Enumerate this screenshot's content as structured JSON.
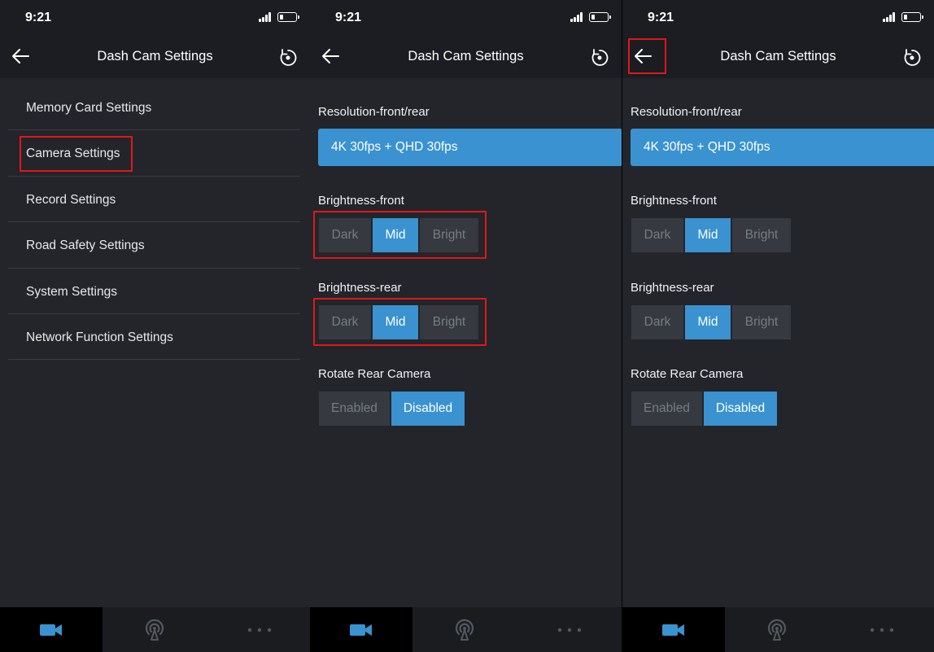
{
  "screens": [
    {
      "status": {
        "time": "9:21"
      },
      "nav": {
        "title": "Dash Cam Settings"
      },
      "menu": [
        {
          "label": "Memory Card Settings"
        },
        {
          "label": "Camera Settings"
        },
        {
          "label": "Record Settings"
        },
        {
          "label": "Road Safety Settings"
        },
        {
          "label": "System Settings"
        },
        {
          "label": "Network Function Settings"
        }
      ]
    },
    {
      "status": {
        "time": "9:21"
      },
      "nav": {
        "title": "Dash Cam Settings"
      },
      "resolution": {
        "label": "Resolution-front/rear",
        "value": "4K 30fps + QHD 30fps"
      },
      "brightness_front": {
        "label": "Brightness-front",
        "options": [
          "Dark",
          "Mid",
          "Bright"
        ],
        "selected": "Mid"
      },
      "brightness_rear": {
        "label": "Brightness-rear",
        "options": [
          "Dark",
          "Mid",
          "Bright"
        ],
        "selected": "Mid"
      },
      "rotate": {
        "label": "Rotate Rear Camera",
        "options": [
          "Enabled",
          "Disabled"
        ],
        "selected": "Disabled"
      }
    },
    {
      "status": {
        "time": "9:21"
      },
      "nav": {
        "title": "Dash Cam Settings"
      },
      "resolution": {
        "label": "Resolution-front/rear",
        "value": "4K 30fps + QHD 30fps"
      },
      "brightness_front": {
        "label": "Brightness-front",
        "options": [
          "Dark",
          "Mid",
          "Bright"
        ],
        "selected": "Mid"
      },
      "brightness_rear": {
        "label": "Brightness-rear",
        "options": [
          "Dark",
          "Mid",
          "Bright"
        ],
        "selected": "Mid"
      },
      "rotate": {
        "label": "Rotate Rear Camera",
        "options": [
          "Enabled",
          "Disabled"
        ],
        "selected": "Disabled"
      }
    }
  ],
  "colors": {
    "accent": "#3a92d0",
    "background": "#23252b",
    "bar": "#1b1d22",
    "segment_inactive": "#363a40",
    "highlight": "#e01818"
  },
  "icons": {
    "back": "arrow-left-icon",
    "reset": "reset-icon",
    "tab_camera": "video-camera-icon",
    "tab_signal": "broadcast-icon",
    "tab_more": "more-dots-icon"
  }
}
